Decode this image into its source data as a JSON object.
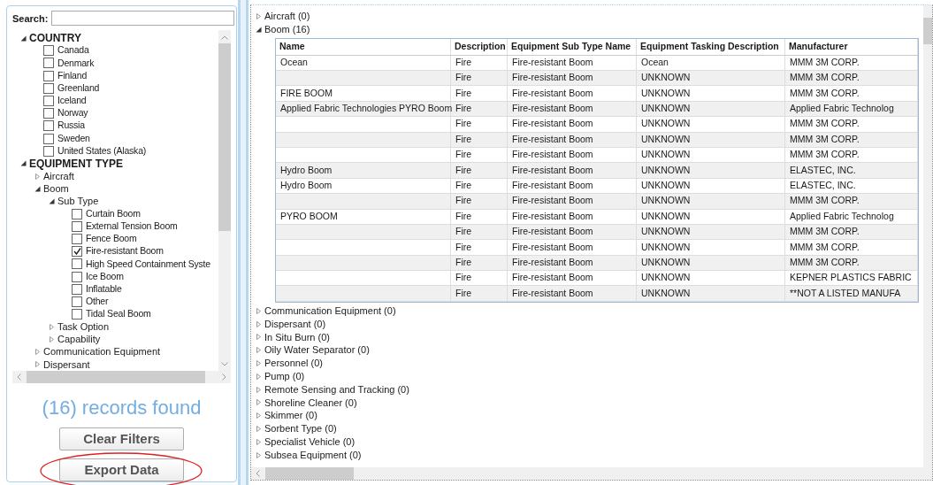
{
  "filter_panel": {
    "search_label": "Search:",
    "tree": [
      {
        "kind": "expander",
        "label": "COUNTRY",
        "expanded": true,
        "children": [
          {
            "kind": "checkbox",
            "label": "Canada",
            "checked": false
          },
          {
            "kind": "checkbox",
            "label": "Denmark",
            "checked": false
          },
          {
            "kind": "checkbox",
            "label": "Finland",
            "checked": false
          },
          {
            "kind": "checkbox",
            "label": "Greenland",
            "checked": false
          },
          {
            "kind": "checkbox",
            "label": "Iceland",
            "checked": false
          },
          {
            "kind": "checkbox",
            "label": "Norway",
            "checked": false
          },
          {
            "kind": "checkbox",
            "label": "Russia",
            "checked": false
          },
          {
            "kind": "checkbox",
            "label": "Sweden",
            "checked": false
          },
          {
            "kind": "checkbox",
            "label": "United States (Alaska)",
            "checked": false
          }
        ]
      },
      {
        "kind": "expander",
        "label": "EQUIPMENT TYPE",
        "expanded": true,
        "children": [
          {
            "kind": "expander",
            "label": "Aircraft",
            "expanded": false
          },
          {
            "kind": "expander",
            "label": "Boom",
            "expanded": true,
            "children": [
              {
                "kind": "expander",
                "label": "Sub Type",
                "expanded": true,
                "children": [
                  {
                    "kind": "checkbox",
                    "label": "Curtain Boom",
                    "checked": false
                  },
                  {
                    "kind": "checkbox",
                    "label": "External Tension Boom",
                    "checked": false
                  },
                  {
                    "kind": "checkbox",
                    "label": "Fence Boom",
                    "checked": false
                  },
                  {
                    "kind": "checkbox",
                    "label": "Fire-resistant Boom",
                    "checked": true
                  },
                  {
                    "kind": "checkbox",
                    "label": "High Speed Containment Syste",
                    "checked": false
                  },
                  {
                    "kind": "checkbox",
                    "label": "Ice Boom",
                    "checked": false
                  },
                  {
                    "kind": "checkbox",
                    "label": "Inflatable",
                    "checked": false
                  },
                  {
                    "kind": "checkbox",
                    "label": "Other",
                    "checked": false
                  },
                  {
                    "kind": "checkbox",
                    "label": "Tidal Seal Boom",
                    "checked": false
                  }
                ]
              },
              {
                "kind": "expander",
                "label": "Task Option",
                "expanded": false
              },
              {
                "kind": "expander",
                "label": "Capability",
                "expanded": false
              }
            ]
          },
          {
            "kind": "expander",
            "label": "Communication Equipment",
            "expanded": false
          },
          {
            "kind": "expander",
            "label": "Dispersant",
            "expanded": false
          }
        ]
      }
    ],
    "records_found": "(16) records found",
    "buttons": [
      {
        "label": "Clear Filters",
        "highlighted": false
      },
      {
        "label": "Export Data",
        "highlighted": true
      }
    ]
  },
  "results": {
    "groups": [
      {
        "label": "Aircraft (0)",
        "expanded": false
      },
      {
        "label": "Boom (16)",
        "expanded": true,
        "table": {
          "columns": [
            "Name",
            "Description",
            "Equipment Sub Type Name",
            "Equipment Tasking Description",
            "Manufacturer"
          ],
          "rows": [
            [
              "Ocean",
              "Fire",
              "Fire-resistant Boom",
              "Ocean",
              "MMM 3M CORP."
            ],
            [
              "",
              "Fire",
              "Fire-resistant Boom",
              "UNKNOWN",
              "MMM 3M CORP."
            ],
            [
              "FIRE BOOM",
              "Fire",
              "Fire-resistant Boom",
              "UNKNOWN",
              "MMM 3M CORP."
            ],
            [
              "Applied Fabric Technologies PYRO Boom",
              "Fire",
              "Fire-resistant Boom",
              "UNKNOWN",
              "Applied Fabric Technolog"
            ],
            [
              "",
              "Fire",
              "Fire-resistant Boom",
              "UNKNOWN",
              "MMM 3M CORP."
            ],
            [
              "",
              "Fire",
              "Fire-resistant Boom",
              "UNKNOWN",
              "MMM 3M CORP."
            ],
            [
              "",
              "Fire",
              "Fire-resistant Boom",
              "UNKNOWN",
              "MMM 3M CORP."
            ],
            [
              "Hydro Boom",
              "Fire",
              "Fire-resistant Boom",
              "UNKNOWN",
              "ELASTEC, INC."
            ],
            [
              "Hydro Boom",
              "Fire",
              "Fire-resistant Boom",
              "UNKNOWN",
              "ELASTEC, INC."
            ],
            [
              "",
              "Fire",
              "Fire-resistant Boom",
              "UNKNOWN",
              "MMM 3M CORP."
            ],
            [
              "PYRO BOOM",
              "Fire",
              "Fire-resistant Boom",
              "UNKNOWN",
              "Applied Fabric Technolog"
            ],
            [
              "",
              "Fire",
              "Fire-resistant Boom",
              "UNKNOWN",
              "MMM 3M CORP."
            ],
            [
              "",
              "Fire",
              "Fire-resistant Boom",
              "UNKNOWN",
              "MMM 3M CORP."
            ],
            [
              "",
              "Fire",
              "Fire-resistant Boom",
              "UNKNOWN",
              "MMM 3M CORP."
            ],
            [
              "",
              "Fire",
              "Fire-resistant Boom",
              "UNKNOWN",
              "KEPNER PLASTICS FABRIC"
            ],
            [
              "",
              "Fire",
              "Fire-resistant Boom",
              "UNKNOWN",
              "**NOT A LISTED MANUFA"
            ]
          ]
        }
      },
      {
        "label": "Communication Equipment (0)",
        "expanded": false
      },
      {
        "label": "Dispersant (0)",
        "expanded": false
      },
      {
        "label": "In Situ Burn (0)",
        "expanded": false
      },
      {
        "label": "Oily Water Separator (0)",
        "expanded": false
      },
      {
        "label": "Personnel (0)",
        "expanded": false
      },
      {
        "label": "Pump (0)",
        "expanded": false
      },
      {
        "label": "Remote Sensing and Tracking (0)",
        "expanded": false
      },
      {
        "label": "Shoreline Cleaner (0)",
        "expanded": false
      },
      {
        "label": "Skimmer (0)",
        "expanded": false
      },
      {
        "label": "Sorbent Type (0)",
        "expanded": false
      },
      {
        "label": "Specialist Vehicle (0)",
        "expanded": false
      },
      {
        "label": "Subsea Equipment (0)",
        "expanded": false
      }
    ]
  }
}
